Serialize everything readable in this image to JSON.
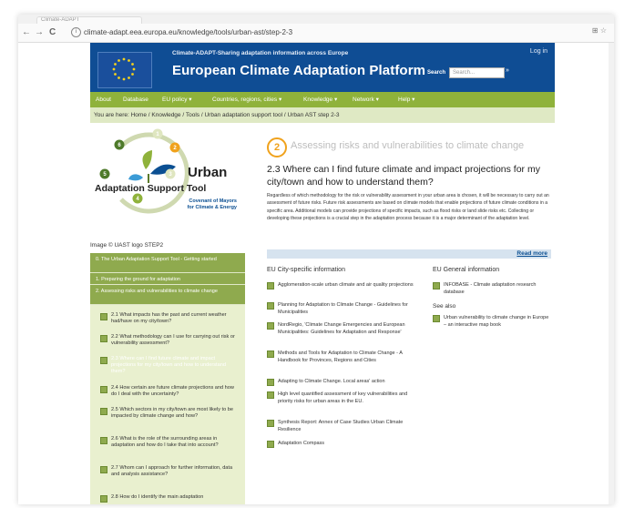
{
  "browser": {
    "tab_title": "Climate-ADAPT",
    "url": "climate-adapt.eea.europa.eu/knowledge/tools/urban-ast/step-2-3",
    "back": "←",
    "forward": "→",
    "reload": "C",
    "info": "i",
    "extensions": "⊞  ☆"
  },
  "header": {
    "tagline": "Climate-ADAPT-Sharing adaptation information across Europe",
    "title": "European Climate Adaptation Platform",
    "login": "Log in",
    "search_label": "Search",
    "search_placeholder": "Search...",
    "search_button": "»"
  },
  "menu": [
    {
      "label": "About"
    },
    {
      "label": "Database"
    },
    {
      "label": "EU policy ▾"
    },
    {
      "label": "Countries, regions, cities ▾"
    },
    {
      "label": "Knowledge ▾"
    },
    {
      "label": "Network ▾"
    },
    {
      "label": "Help ▾"
    }
  ],
  "breadcrumb": {
    "prefix": "You are here:",
    "home": "Home",
    "knowledge": "Knowledge",
    "tools": "Tools",
    "uast": "Urban adaptation support tool",
    "current": "Urban AST step 2-3"
  },
  "logo": {
    "urban": "Urban",
    "adaptation": "Adaptation Support Tool",
    "covenant_line1": "Covenant of Mayors",
    "covenant_line2": "for Climate & Energy",
    "numbers": [
      "1",
      "2",
      "3",
      "4",
      "5",
      "6"
    ],
    "caption": "Image ©   UAST logo STEP2"
  },
  "sidebar": {
    "steps": [
      {
        "label": "0. The Urban Adaptation Support Tool - Getting started"
      },
      {
        "label": "1. Preparing the ground for adaptation"
      },
      {
        "label": "2. Assessing risks and vulnerabilities to climate change"
      }
    ],
    "substeps": [
      {
        "label": "2.1 What impacts has the past and current weather had/have on my city/town?"
      },
      {
        "label": "2.2 What methodology can I use for carrying out risk or vulnerability assessment?"
      },
      {
        "label": "2.3 Where can I find future climate and impact projections for my city/town and how to understand them?"
      },
      {
        "label": "2.4 How certain are future climate projections and how do I deal with the uncertainty?"
      },
      {
        "label": "2.5 Which sectors in my city/town are most likely to be impacted by climate change and how?"
      },
      {
        "label": "2.6 What is the role of the surrounding areas in adaptation and how do I take that into account?"
      },
      {
        "label": "2.7 Whom can I approach for further information, data and analysis assistance?"
      },
      {
        "label": "2.8 How do I identify the main adaptation"
      }
    ]
  },
  "main": {
    "step_number": "2",
    "step_title": "Assessing risks and vulnerabilities to climate change",
    "heading": "2.3 Where can I find future climate and impact projections for my city/town and how to understand them?",
    "paragraph": "Regardless of which methodology for the risk or vulnerability assessment in your urban area is chosen, it will be necessary to carry out an assessment of future risks. Future risk assessments are based on climate models that enable projections of future climate conditions in a specific area. Additional models can provide projections of specific impacts, such as flood risks or land slide risks etc. Collecting or developing these projections is a crucial step in the adaptation process because it is a major determinant of the adaptation level.",
    "read_more": "Read more",
    "eu_city_heading": "EU City-specific information",
    "eu_city_links": [
      {
        "label": "Agglomeration-scale urban climate and air quality projections"
      },
      {
        "label": "Planning for Adaptation to Climate Change - Guidelines for Municipalities"
      },
      {
        "label": "NordRegio, 'Climate Change Emergencies and European Municipalities: Guidelines for Adaptation and Response'"
      },
      {
        "label": "Methods and Tools for Adaptation to Climate Change - A Handbook for Provinces, Regions and Cities"
      },
      {
        "label": "Adapting to Climate Change. Local areas' action"
      },
      {
        "label": "High level quantified assessment of key vulnerabilities and priority risks for urban areas in the EU."
      },
      {
        "label": "Synthesis Report: Annex of Case Studies Urban Climate Resilience"
      },
      {
        "label": "Adaptation Compass"
      }
    ],
    "eu_general_heading": "EU General information",
    "eu_general_links": [
      {
        "label": "INFOBASE - Climate adaptation research database"
      }
    ],
    "see_also": "See also",
    "see_also_links": [
      {
        "label": "Urban vulnerability to climate change in Europe – an interactive map book"
      }
    ]
  }
}
